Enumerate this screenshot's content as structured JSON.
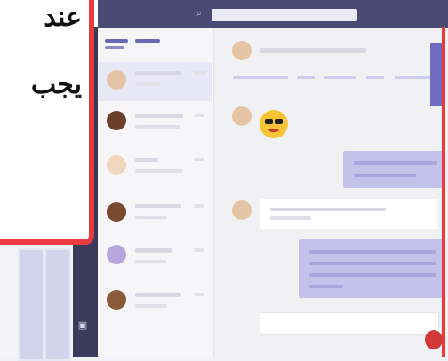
{
  "callout": {
    "line1": "عند",
    "line2": "يجب"
  },
  "colors": {
    "accent": "#4b4a75",
    "callout_border": "#e83b3e",
    "sent_bubble": "#c4c1ea"
  },
  "icons": {
    "search": "search-icon",
    "files": "files-icon",
    "emoji": "sunglasses-emoji"
  }
}
